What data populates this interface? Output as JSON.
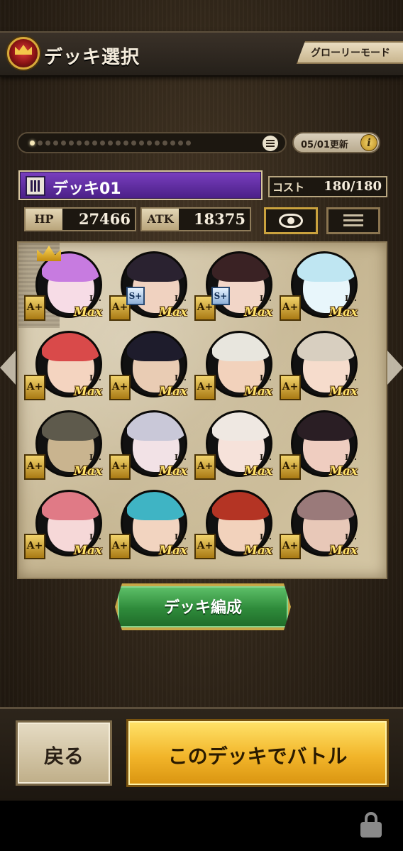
{
  "header": {
    "title": "デッキ選択",
    "mode_button": "グローリーモード"
  },
  "pager": {
    "total": 21,
    "active_index": 0,
    "update_text": "05/01更新",
    "info_glyph": "i"
  },
  "deck": {
    "name": "デッキ01",
    "cost_label": "コスト",
    "cost_value": "180/180",
    "hp_label": "HP",
    "hp_value": "27466",
    "atk_label": "ATK",
    "atk_value": "18375"
  },
  "cards": [
    {
      "rank": "A+",
      "lv": "Lv.",
      "max": "Max",
      "leader": true
    },
    {
      "rank": "A+",
      "lv": "Lv.",
      "max": "Max",
      "extra_rank": "S+"
    },
    {
      "rank": "A+",
      "lv": "Lv.",
      "max": "Max",
      "extra_rank": "S+"
    },
    {
      "rank": "A+",
      "lv": "Lv.",
      "max": "Max"
    },
    {
      "rank": "A+",
      "lv": "Lv.",
      "max": "Max"
    },
    {
      "rank": "A+",
      "lv": "Lv.",
      "max": "Max"
    },
    {
      "rank": "A+",
      "lv": "Lv.",
      "max": "Max"
    },
    {
      "rank": "A+",
      "lv": "Lv.",
      "max": "Max"
    },
    {
      "rank": "A+",
      "lv": "Lv.",
      "max": "Max"
    },
    {
      "rank": "A+",
      "lv": "Lv.",
      "max": "Max"
    },
    {
      "rank": "A+",
      "lv": "Lv.",
      "max": "Max"
    },
    {
      "rank": "A+",
      "lv": "Lv.",
      "max": "Max"
    },
    {
      "rank": "A+",
      "lv": "Lv.",
      "max": "Max"
    },
    {
      "rank": "A+",
      "lv": "Lv.",
      "max": "Max"
    },
    {
      "rank": "A+",
      "lv": "Lv.",
      "max": "Max"
    },
    {
      "rank": "A+",
      "lv": "Lv.",
      "max": "Max"
    }
  ],
  "portrait_colors": [
    {
      "hair": "#c77be0",
      "skin": "#f7dce6"
    },
    {
      "hair": "#2a2230",
      "skin": "#f0d2c0"
    },
    {
      "hair": "#3a2224",
      "skin": "#f2d6c8"
    },
    {
      "hair": "#bfe6f2",
      "skin": "#e8f6fb"
    },
    {
      "hair": "#d94a4a",
      "skin": "#f4d4c0"
    },
    {
      "hair": "#1e1c2c",
      "skin": "#e9ccb4"
    },
    {
      "hair": "#e8e6de",
      "skin": "#f2d2bc"
    },
    {
      "hair": "#d8cfc0",
      "skin": "#f6dccc"
    },
    {
      "hair": "#5e5a4c",
      "skin": "#c9b48f"
    },
    {
      "hair": "#c9c8d8",
      "skin": "#f2e2e6"
    },
    {
      "hair": "#efe8e2",
      "skin": "#f6e2da"
    },
    {
      "hair": "#2a1e24",
      "skin": "#efcdc0"
    },
    {
      "hair": "#e07a86",
      "skin": "#f6d8d8"
    },
    {
      "hair": "#3fb4c4",
      "skin": "#f2d4c0"
    },
    {
      "hair": "#b43424",
      "skin": "#f2d2bc"
    },
    {
      "hair": "#9a7a7a",
      "skin": "#e8c8b8"
    }
  ],
  "buttons": {
    "edit": "デッキ編成",
    "back": "戻る",
    "battle": "このデッキでバトル"
  }
}
